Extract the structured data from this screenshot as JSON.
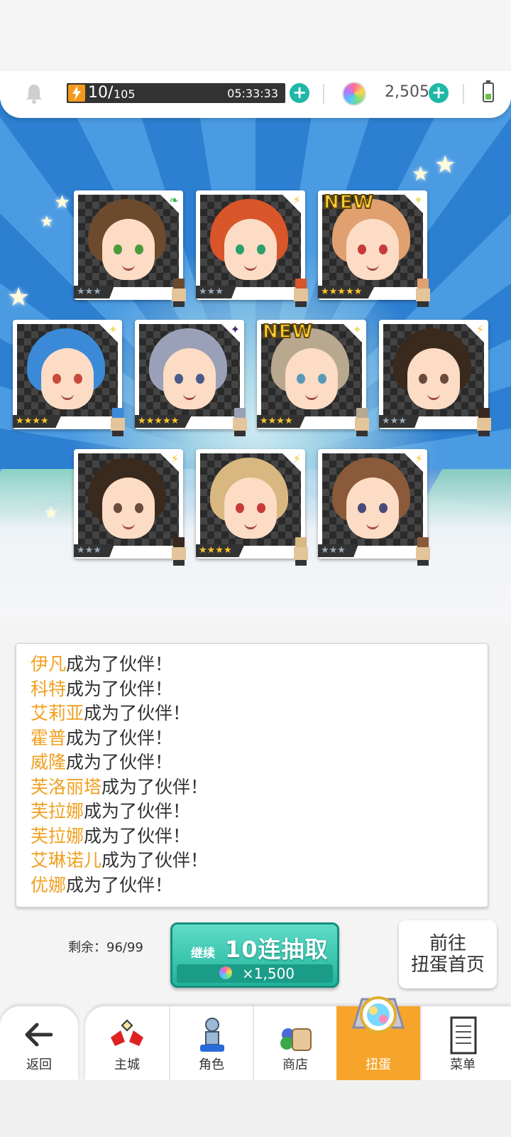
{
  "top_bar": {
    "stamina_value": "10/",
    "stamina_max": "105",
    "stamina_timer": "05:33:33",
    "gems": "2,505"
  },
  "cards": [
    {
      "attr": "leaf",
      "rarity": "★★★",
      "new": false,
      "hair": "#6b4a2e",
      "eye": "#4a9a3a",
      "rarity_color": "silver"
    },
    {
      "attr": "bolt",
      "rarity": "★★★",
      "new": false,
      "hair": "#d9552a",
      "eye": "#2aa06a",
      "rarity_color": "silver"
    },
    {
      "attr": "spark",
      "rarity": "★★★★★",
      "new": true,
      "hair": "#e0a070",
      "eye": "#c83a3a",
      "rarity_color": "gold"
    },
    {
      "attr": "spark",
      "rarity": "★★★★",
      "new": false,
      "hair": "#3a8ad8",
      "eye": "#c84a3a",
      "rarity_color": "gold"
    },
    {
      "attr": "dark",
      "rarity": "★★★★★",
      "new": false,
      "hair": "#9aa0b8",
      "eye": "#4a5a8a",
      "rarity_color": "gold"
    },
    {
      "attr": "spark",
      "rarity": "★★★★",
      "new": true,
      "hair": "#b8a890",
      "eye": "#5a9ab8",
      "rarity_color": "gold"
    },
    {
      "attr": "bolt",
      "rarity": "★★★",
      "new": false,
      "hair": "#3a2a1e",
      "eye": "#6a4a3a",
      "rarity_color": "silver"
    },
    {
      "attr": "bolt",
      "rarity": "★★★",
      "new": false,
      "hair": "#3a2a1e",
      "eye": "#6a4a3a",
      "rarity_color": "silver"
    },
    {
      "attr": "bolt",
      "rarity": "★★★★",
      "new": false,
      "hair": "#d8b880",
      "eye": "#c83a3a",
      "rarity_color": "gold"
    },
    {
      "attr": "bolt",
      "rarity": "★★★",
      "new": false,
      "hair": "#8a5a3a",
      "eye": "#4a4a7a",
      "rarity_color": "silver"
    }
  ],
  "new_label": "NEW",
  "log": {
    "suffix": "成为了伙伴！",
    "names": [
      "伊凡",
      "科特",
      "艾莉亚",
      "霍普",
      "威隆",
      "芙洛丽塔",
      "芙拉娜",
      "芙拉娜",
      "艾琳诺儿",
      "优娜"
    ]
  },
  "actions": {
    "remaining": "剩余：96/99",
    "pull_small": "继续",
    "pull_main": "10连抽取",
    "pull_cost": "×1,500",
    "goto_line1": "前往",
    "goto_line2": "扭蛋首页"
  },
  "nav": {
    "back": "返回",
    "tabs": [
      "主城",
      "角色",
      "商店",
      "扭蛋",
      "菜单"
    ],
    "active": "扭蛋"
  },
  "colors": {
    "accent": "#1fb8a6",
    "name_highlight": "#f0a020",
    "active_tab": "#f6a52a"
  }
}
